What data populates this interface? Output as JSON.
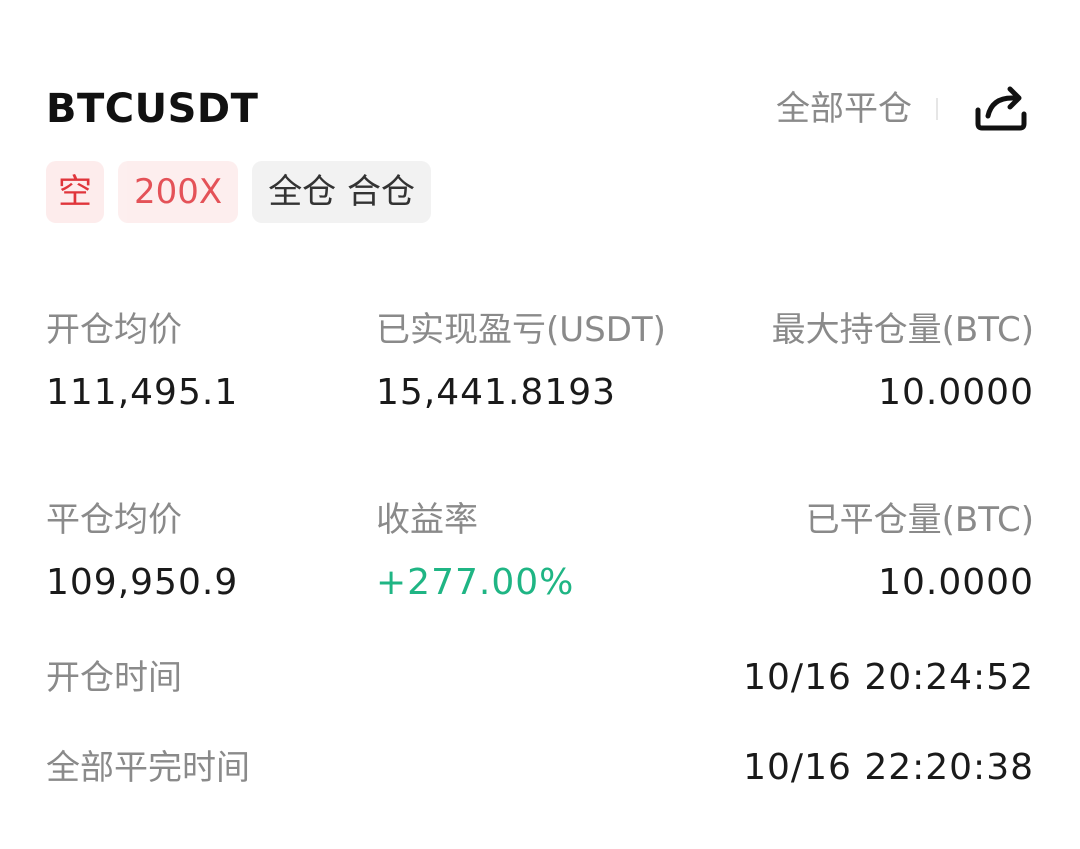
{
  "header": {
    "symbol": "BTCUSDT",
    "close_all_label": "全部平仓",
    "share_icon": "share-icon"
  },
  "tags": {
    "side": "空",
    "leverage": "200X",
    "margin_mode": "全仓 合仓"
  },
  "stats": {
    "open_avg_price_label": "开仓均价",
    "open_avg_price_value": "111,495.1",
    "realized_pnl_label": "已实现盈亏(USDT)",
    "realized_pnl_value": "15,441.8193",
    "max_position_label": "最大持仓量(BTC)",
    "max_position_value": "10.0000",
    "close_avg_price_label": "平仓均价",
    "close_avg_price_value": "109,950.9",
    "roi_label": "收益率",
    "roi_value": "+277.00%",
    "closed_qty_label": "已平仓量(BTC)",
    "closed_qty_value": "10.0000"
  },
  "times": {
    "open_time_label": "开仓时间",
    "open_time_value": "10/16 20:24:52",
    "close_time_label": "全部平完时间",
    "close_time_value": "10/16 22:20:38"
  },
  "colors": {
    "short_red": "#e0353b",
    "profit_green": "#1fb584",
    "label_gray": "#8a8a8a"
  }
}
